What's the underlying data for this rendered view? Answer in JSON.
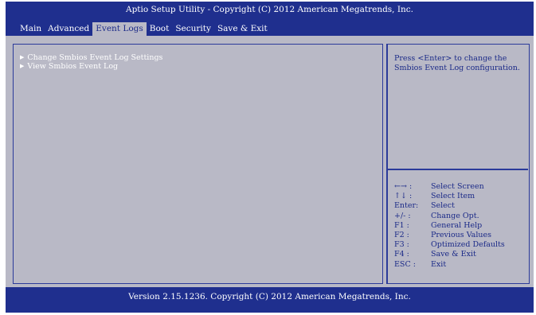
{
  "title": "Aptio Setup Utility - Copyright (C) 2012 American Megatrends, Inc.",
  "tabs": [
    {
      "label": "Main"
    },
    {
      "label": "Advanced"
    },
    {
      "label": "Event Logs"
    },
    {
      "label": "Boot"
    },
    {
      "label": "Security"
    },
    {
      "label": "Save & Exit"
    }
  ],
  "menu": [
    {
      "label": "Change Smbios Event Log Settings"
    },
    {
      "label": "View Smbios Event Log"
    }
  ],
  "help_text": "Press <Enter> to change the Smbios Event Log configuration.",
  "keys": [
    {
      "key": "←→ :",
      "desc": "Select Screen"
    },
    {
      "key": "↑↓ :",
      "desc": "Select Item"
    },
    {
      "key": "Enter:",
      "desc": "Select"
    },
    {
      "key": "+/- :",
      "desc": "Change Opt."
    },
    {
      "key": "F1 :",
      "desc": "General Help"
    },
    {
      "key": "F2 :",
      "desc": "Previous Values"
    },
    {
      "key": "F3 :",
      "desc": "Optimized Defaults"
    },
    {
      "key": "F4 :",
      "desc": "Save & Exit"
    },
    {
      "key": "ESC :",
      "desc": "Exit"
    }
  ],
  "footer": "Version 2.15.1236. Copyright (C) 2012 American Megatrends, Inc.",
  "colors": {
    "frame": "#1f2f8e",
    "panel": "#b9b9c6",
    "active_tab": "#b9b9c6",
    "text_on_panel": "#1b2a88"
  },
  "active_tab": "Event Logs"
}
